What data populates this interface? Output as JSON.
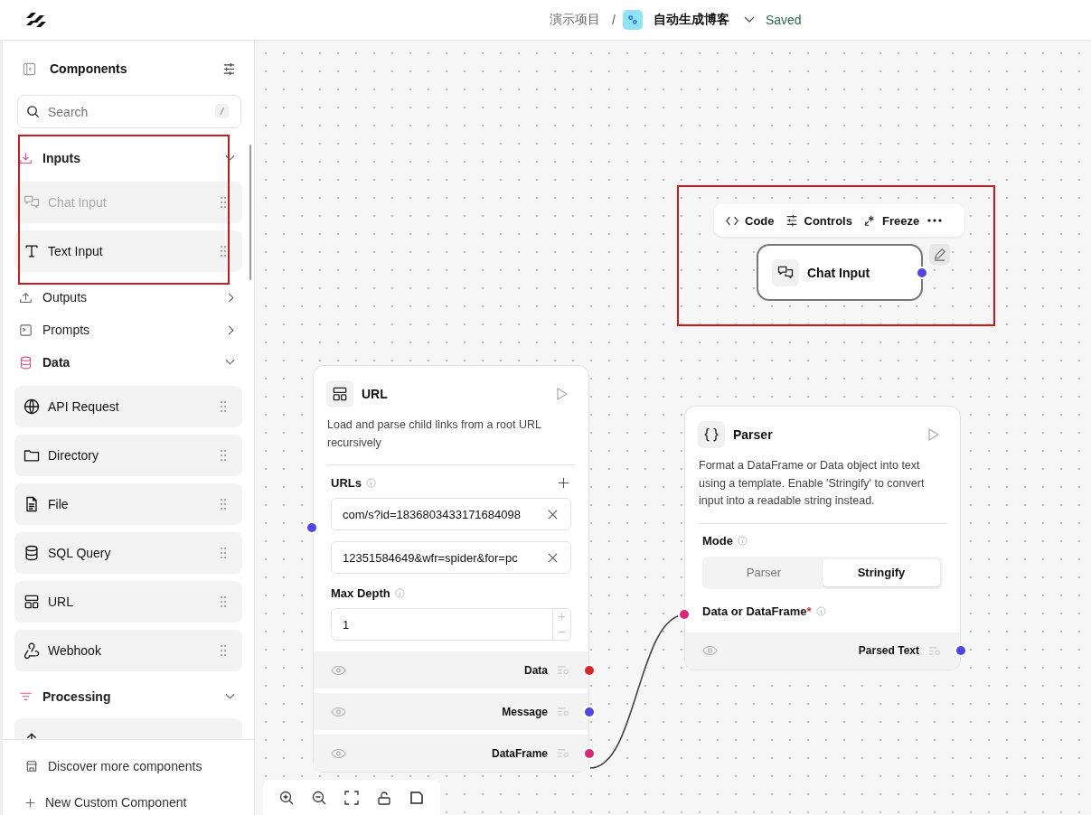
{
  "header": {
    "project": "演示项目",
    "separator": "/",
    "flow_title": "自动生成博客",
    "save_status": "Saved"
  },
  "sidebar": {
    "title": "Components",
    "search": {
      "placeholder": "Search",
      "shortcut": "/"
    },
    "categories": [
      {
        "label": "Inputs",
        "expanded": true,
        "items": [
          {
            "label": "Chat Input",
            "disabled": true
          },
          {
            "label": "Text Input",
            "disabled": false
          }
        ]
      },
      {
        "label": "Outputs",
        "expanded": false
      },
      {
        "label": "Prompts",
        "expanded": false
      },
      {
        "label": "Data",
        "expanded": true,
        "items": [
          {
            "label": "API Request",
            "disabled": false
          },
          {
            "label": "Directory",
            "disabled": false
          },
          {
            "label": "File",
            "disabled": false
          },
          {
            "label": "SQL Query",
            "disabled": false
          },
          {
            "label": "URL",
            "disabled": false
          },
          {
            "label": "Webhook",
            "disabled": false
          }
        ]
      },
      {
        "label": "Processing",
        "expanded": true
      }
    ],
    "footer": [
      "Discover more components",
      "New Custom Component"
    ]
  },
  "canvas": {
    "chat_node": {
      "title": "Chat Input",
      "selected": true,
      "toolbar": [
        "Code",
        "Controls",
        "Freeze"
      ]
    },
    "url_node": {
      "title": "URL",
      "description": "Load and parse child links from a root URL recursively",
      "urls_label": "URLs",
      "urls": [
        "com/s?id=1836803433171684098",
        "12351584649&wfr=spider&for=pc"
      ],
      "max_depth_label": "Max Depth",
      "max_depth": "1",
      "outputs": [
        {
          "label": "Data",
          "color": "#dc2626"
        },
        {
          "label": "Message",
          "color": "#4f46e5"
        },
        {
          "label": "DataFrame",
          "color": "#db2777"
        }
      ]
    },
    "parser_node": {
      "title": "Parser",
      "description": "Format a DataFrame or Data object into text using a template. Enable 'Stringify' to convert input into a readable string instead.",
      "mode_label": "Mode",
      "modes": [
        {
          "label": "Parser",
          "selected": false
        },
        {
          "label": "Stringify",
          "selected": true
        }
      ],
      "input": {
        "label": "Data or DataFrame",
        "required": true,
        "required_marker": "*"
      },
      "outputs": [
        {
          "label": "Parsed Text",
          "color": "#4f46e5"
        }
      ]
    }
  }
}
